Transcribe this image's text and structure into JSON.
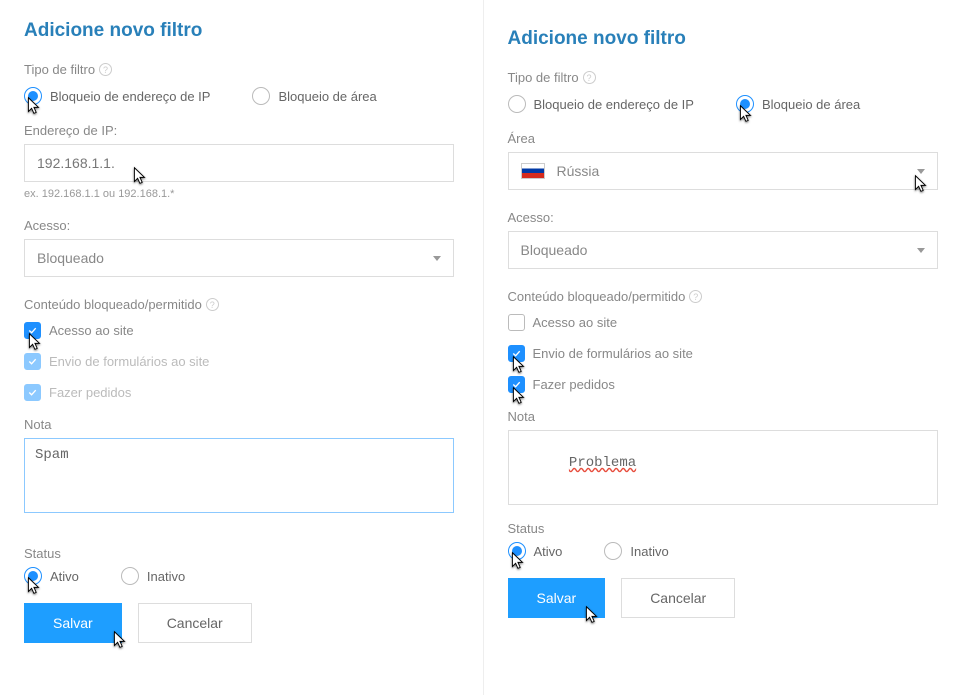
{
  "left": {
    "title": "Adicione novo filtro",
    "filterType": {
      "label": "Tipo de filtro",
      "options": {
        "ip": "Bloqueio de endereço de IP",
        "area": "Bloqueio de área"
      },
      "selected": "ip"
    },
    "ip": {
      "label": "Endereço de IP:",
      "value": "192.168.1.1.",
      "hint": "ex. 192.168.1.1 ou 192.168.1.*"
    },
    "access": {
      "label": "Acesso:",
      "value": "Bloqueado"
    },
    "content": {
      "label": "Conteúdo bloqueado/permitido",
      "site": "Acesso ao site",
      "forms": "Envio de formulários ao site",
      "orders": "Fazer pedidos"
    },
    "note": {
      "label": "Nota",
      "value": "Spam"
    },
    "status": {
      "label": "Status",
      "active": "Ativo",
      "inactive": "Inativo",
      "selected": "active"
    },
    "buttons": {
      "save": "Salvar",
      "cancel": "Cancelar"
    }
  },
  "right": {
    "title": "Adicione novo filtro",
    "filterType": {
      "label": "Tipo de filtro",
      "options": {
        "ip": "Bloqueio de endereço de IP",
        "area": "Bloqueio de área"
      },
      "selected": "area"
    },
    "area": {
      "label": "Área",
      "value": "Rússia"
    },
    "access": {
      "label": "Acesso:",
      "value": "Bloqueado"
    },
    "content": {
      "label": "Conteúdo bloqueado/permitido",
      "site": "Acesso ao site",
      "forms": "Envio de formulários ao site",
      "orders": "Fazer pedidos"
    },
    "note": {
      "label": "Nota",
      "value": "Problema"
    },
    "status": {
      "label": "Status",
      "active": "Ativo",
      "inactive": "Inativo",
      "selected": "active"
    },
    "buttons": {
      "save": "Salvar",
      "cancel": "Cancelar"
    }
  }
}
